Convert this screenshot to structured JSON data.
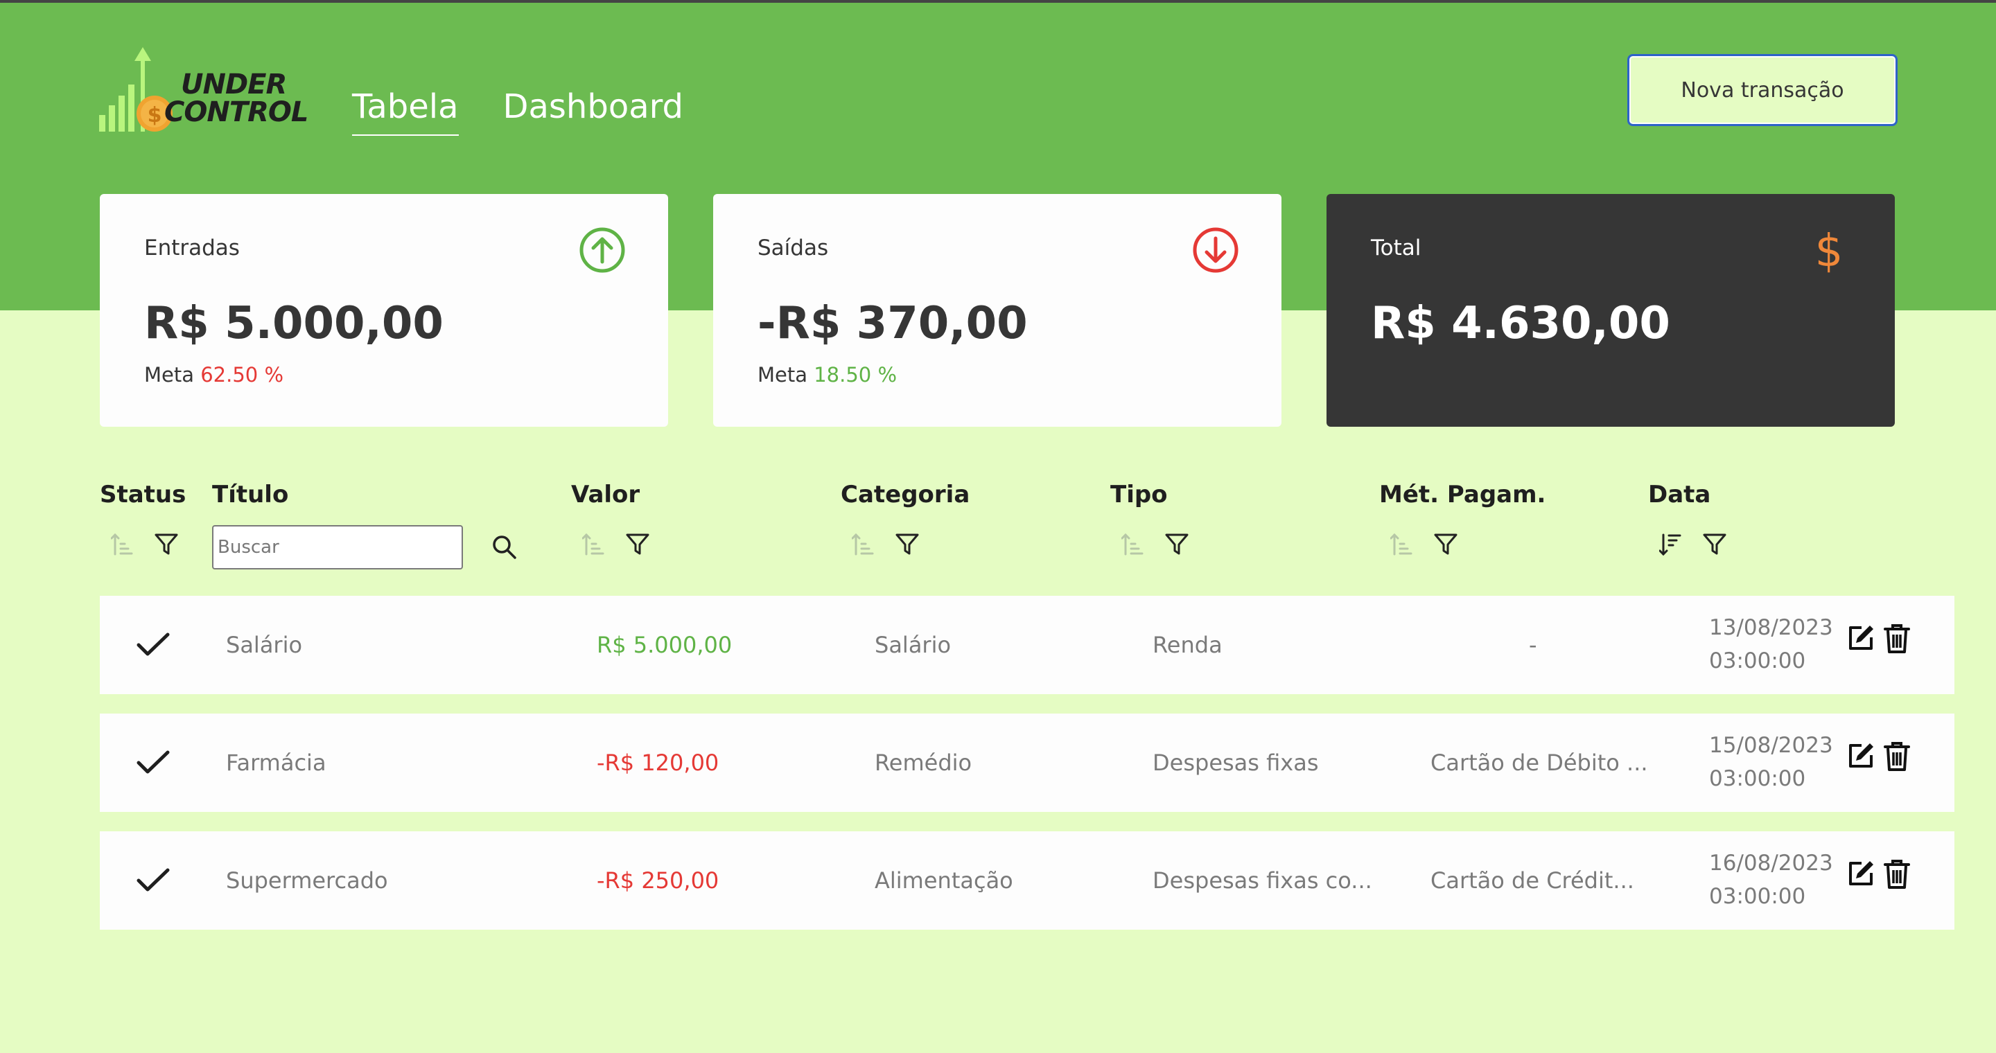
{
  "brand": {
    "line1": "UNDER",
    "line2": "CONTROL"
  },
  "nav": {
    "tabs": [
      {
        "label": "Tabela",
        "active": true
      },
      {
        "label": "Dashboard",
        "active": false
      }
    ]
  },
  "header": {
    "new_transaction_label": "Nova transação"
  },
  "summary": {
    "income": {
      "label": "Entradas",
      "amount": "R$ 5.000,00",
      "meta_label": "Meta",
      "meta_value": "62.50 %"
    },
    "expenses": {
      "label": "Saídas",
      "amount": "-R$ 370,00",
      "meta_label": "Meta",
      "meta_value": "18.50 %"
    },
    "total": {
      "label": "Total",
      "amount": "R$ 4.630,00"
    }
  },
  "table": {
    "columns": [
      "Status",
      "Título",
      "Valor",
      "Categoria",
      "Tipo",
      "Mét. Pagam.",
      "Data"
    ],
    "search_placeholder": "Buscar",
    "rows": [
      {
        "status": "done",
        "title": "Salário",
        "value": "R$ 5.000,00",
        "value_type": "income",
        "category": "Salário",
        "type": "Renda",
        "payment": "-",
        "date": "13/08/2023",
        "time": "03:00:00"
      },
      {
        "status": "done",
        "title": "Farmácia",
        "value": "-R$ 120,00",
        "value_type": "expense",
        "category": "Remédio",
        "type": "Despesas fixas",
        "payment": "Cartão de Débito ...",
        "date": "15/08/2023",
        "time": "03:00:00"
      },
      {
        "status": "done",
        "title": "Supermercado",
        "value": "-R$ 250,00",
        "value_type": "expense",
        "category": "Alimentação",
        "type": "Despesas fixas co...",
        "payment": "Cartão de Crédit...",
        "date": "16/08/2023",
        "time": "03:00:00"
      }
    ]
  },
  "colors": {
    "header_green": "#6cbb51",
    "background": "#e5fcc3",
    "dark_card": "#363636",
    "income": "#5fb346",
    "expense": "#e53935",
    "accent_blue": "#2e63c9",
    "dollar_orange": "#f0883a"
  },
  "icons": [
    "logo-chart-icon",
    "arrow-up-circle-icon",
    "arrow-down-circle-icon",
    "dollar-icon",
    "sort-icon",
    "filter-icon",
    "search-icon",
    "check-icon",
    "edit-icon",
    "trash-icon"
  ]
}
